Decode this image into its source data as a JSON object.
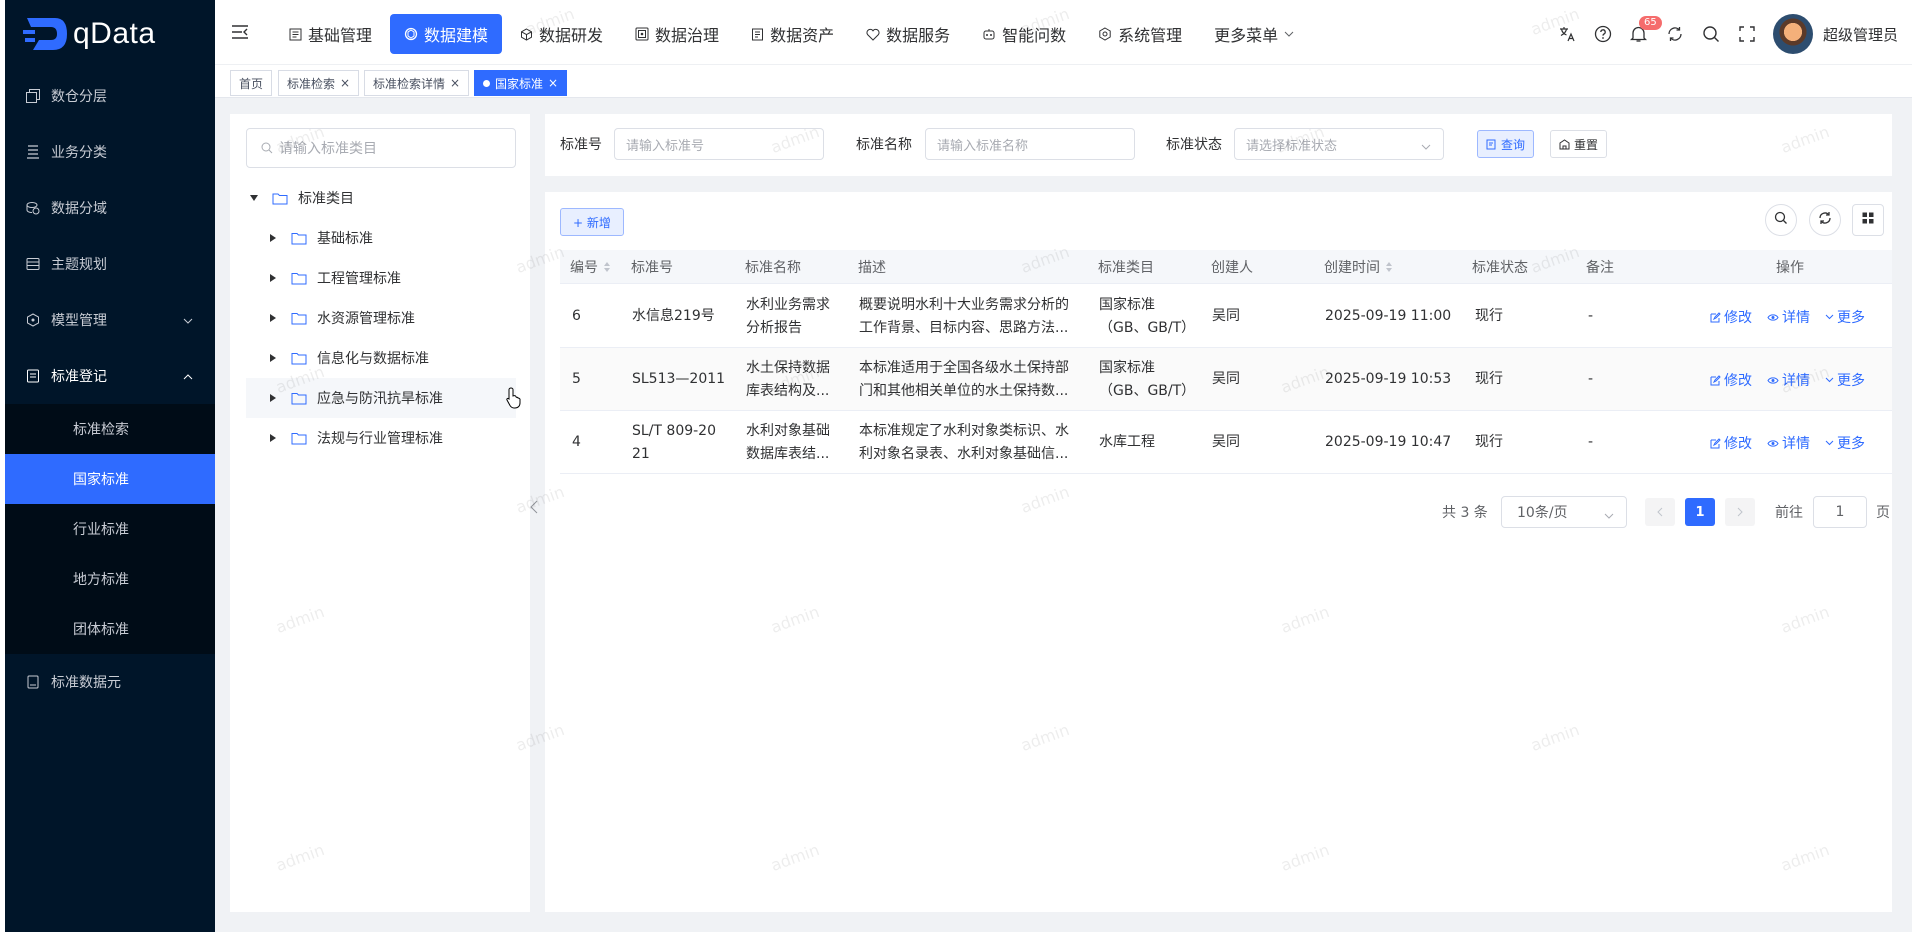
{
  "logo": {
    "text": "qData"
  },
  "sidebar": {
    "items": [
      {
        "label": "数仓分层",
        "icon": "copy-icon"
      },
      {
        "label": "业务分类",
        "icon": "list-icon"
      },
      {
        "label": "数据分域",
        "icon": "coins-icon"
      },
      {
        "label": "主题规划",
        "icon": "database-icon"
      },
      {
        "label": "模型管理",
        "icon": "cube-icon",
        "expanded": false
      },
      {
        "label": "标准登记",
        "icon": "document-icon",
        "expanded": true
      },
      {
        "label": "标准数据元",
        "icon": "document-icon"
      }
    ],
    "sub_items": [
      {
        "label": "标准检索",
        "active": false
      },
      {
        "label": "国家标准",
        "active": true
      },
      {
        "label": "行业标准",
        "active": false
      },
      {
        "label": "地方标准",
        "active": false
      },
      {
        "label": "团体标准",
        "active": false
      }
    ]
  },
  "header": {
    "nav": [
      {
        "label": "基础管理",
        "icon": "calendar-icon"
      },
      {
        "label": "数据建模",
        "icon": "model-icon",
        "active": true
      },
      {
        "label": "数据研发",
        "icon": "cube-icon"
      },
      {
        "label": "数据治理",
        "icon": "image-icon"
      },
      {
        "label": "数据资产",
        "icon": "asset-icon"
      },
      {
        "label": "数据服务",
        "icon": "heart-icon"
      },
      {
        "label": "智能问数",
        "icon": "robot-icon"
      },
      {
        "label": "系统管理",
        "icon": "gear-icon"
      },
      {
        "label": "更多菜单",
        "icon": "chevron-down-icon"
      }
    ],
    "notification_count": "65",
    "username": "超级管理员"
  },
  "tabs": [
    {
      "label": "首页",
      "closable": false,
      "active": false
    },
    {
      "label": "标准检索",
      "closable": true,
      "active": false
    },
    {
      "label": "标准检索详情",
      "closable": true,
      "active": false
    },
    {
      "label": "国家标准",
      "closable": true,
      "active": true
    }
  ],
  "tree": {
    "search_placeholder": "请输入标准类目",
    "root": "标准类目",
    "children": [
      "基础标准",
      "工程管理标准",
      "水资源管理标准",
      "信息化与数据标准",
      "应急与防汛抗旱标准",
      "法规与行业管理标准"
    ]
  },
  "filters": {
    "code_label": "标准号",
    "code_placeholder": "请输入标准号",
    "name_label": "标准名称",
    "name_placeholder": "请输入标准名称",
    "status_label": "标准状态",
    "status_placeholder": "请选择标准状态",
    "query_label": "查询",
    "reset_label": "重置"
  },
  "table": {
    "add_label": "+ 新增",
    "columns": [
      "编号",
      "标准号",
      "标准名称",
      "描述",
      "标准类目",
      "创建人",
      "创建时间",
      "标准状态",
      "备注",
      "操作"
    ],
    "rows": [
      {
        "id": "6",
        "code": "水信息219号",
        "name": "水利业务需求分析报告",
        "desc": "概要说明水利十大业务需求分析的工作背景、目标内容、思路方法...",
        "category": "国家标准（GB、GB/T）",
        "creator": "吴同",
        "created": "2025-09-19 11:00",
        "status": "现行",
        "remark": "-"
      },
      {
        "id": "5",
        "code": "SL513—2011",
        "name": "水土保持数据库表结构及...",
        "desc": "本标准适用于全国各级水土保持部门和其他相关单位的水土保持数...",
        "category": "国家标准（GB、GB/T）",
        "creator": "吴同",
        "created": "2025-09-19 10:53",
        "status": "现行",
        "remark": "-"
      },
      {
        "id": "4",
        "code": "SL/T 809-2021",
        "name": "水利对象基础数据库表结...",
        "desc": "本标准规定了水利对象类标识、水利对象名录表、水利对象基础信...",
        "category": "水库工程",
        "creator": "吴同",
        "created": "2025-09-19 10:47",
        "status": "现行",
        "remark": "-"
      }
    ],
    "actions": {
      "edit": "修改",
      "detail": "详情",
      "more": "更多"
    }
  },
  "pagination": {
    "total": "共 3 条",
    "page_size": "10条/页",
    "current": "1",
    "goto_label": "前往",
    "goto_value": "1",
    "page_suffix": "页"
  },
  "watermark_text": "admin",
  "colors": {
    "primary": "#2f6bff",
    "sidebar": "#001529",
    "badge": "#f56c6c"
  }
}
